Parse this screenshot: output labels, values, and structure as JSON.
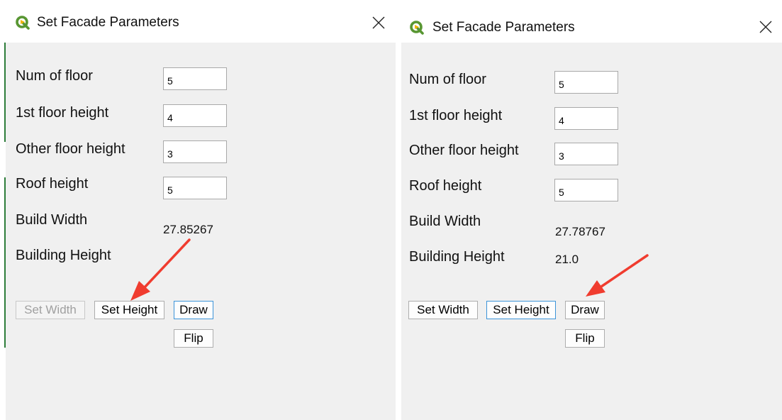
{
  "dialogs": [
    {
      "title": "Set Facade Parameters",
      "fields": [
        {
          "label": "Num of floor",
          "value": "5"
        },
        {
          "label": "1st floor height",
          "value": "4"
        },
        {
          "label": "Other floor height",
          "value": "3"
        },
        {
          "label": "Roof height",
          "value": "5"
        }
      ],
      "build_width_label": "Build Width",
      "build_width_value": "27.85267",
      "building_height_label": "Building Height",
      "building_height_value": "",
      "buttons": {
        "set_width": "Set Width",
        "set_height": "Set Height",
        "draw": "Draw",
        "flip": "Flip"
      }
    },
    {
      "title": "Set Facade Parameters",
      "fields": [
        {
          "label": "Num of floor",
          "value": "5"
        },
        {
          "label": "1st floor height",
          "value": "4"
        },
        {
          "label": "Other floor height",
          "value": "3"
        },
        {
          "label": "Roof height",
          "value": "5"
        }
      ],
      "build_width_label": "Build Width",
      "build_width_value": "27.78767",
      "building_height_label": "Building Height",
      "building_height_value": "21.0",
      "buttons": {
        "set_width": "Set Width",
        "set_height": "Set Height",
        "draw": "Draw",
        "flip": "Flip"
      }
    }
  ],
  "colors": {
    "annotation_arrow": "#f03c2f",
    "focus_border": "#3c94d9",
    "qgis_green": "#589632",
    "qgis_yellow": "#f0b400"
  },
  "icons": [
    "qgis-logo-icon",
    "close-icon"
  ]
}
